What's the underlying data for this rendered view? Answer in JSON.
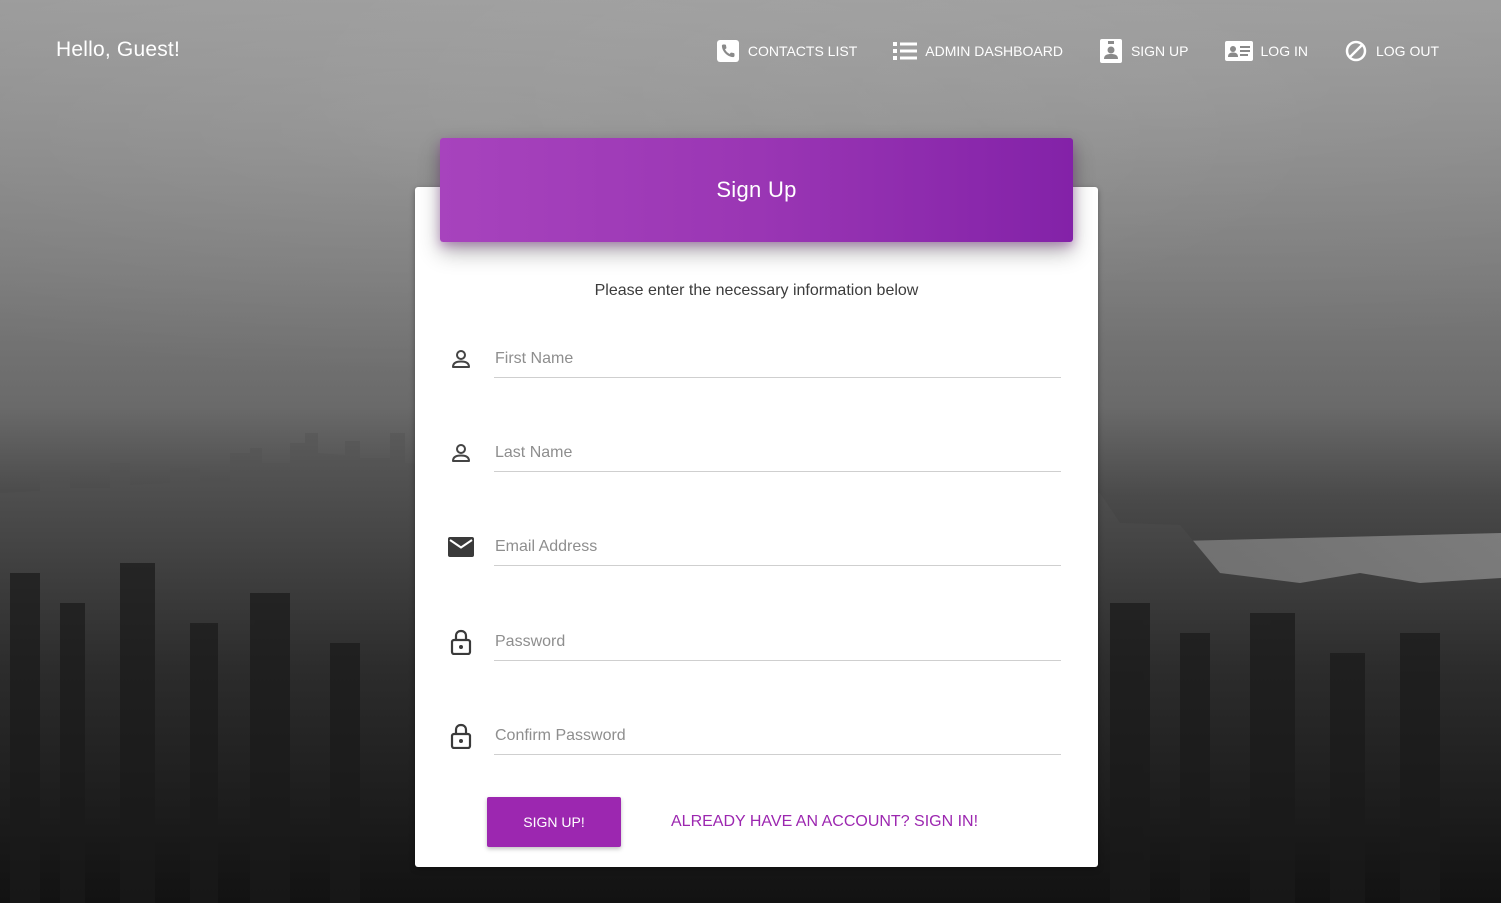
{
  "header": {
    "greeting": "Hello, Guest!",
    "nav": [
      {
        "label": "CONTACTS LIST",
        "icon": "phone-icon"
      },
      {
        "label": "ADMIN DASHBOARD",
        "icon": "list-icon"
      },
      {
        "label": "SIGN UP",
        "icon": "user-badge-icon"
      },
      {
        "label": "LOG IN",
        "icon": "id-card-icon"
      },
      {
        "label": "LOG OUT",
        "icon": "block-icon"
      }
    ]
  },
  "form": {
    "title": "Sign Up",
    "subtitle": "Please enter the necessary information below",
    "fields": [
      {
        "placeholder": "First Name",
        "value": "",
        "icon": "person-icon"
      },
      {
        "placeholder": "Last Name",
        "value": "",
        "icon": "person-icon"
      },
      {
        "placeholder": "Email Address",
        "value": "",
        "icon": "mail-icon"
      },
      {
        "placeholder": "Password",
        "value": "",
        "icon": "lock-icon"
      },
      {
        "placeholder": "Confirm Password",
        "value": "",
        "icon": "lock-icon"
      }
    ],
    "submit_label": "SIGN UP!",
    "signin_link": "ALREADY HAVE AN ACCOUNT? SIGN IN!"
  },
  "colors": {
    "accent": "#9c27b0",
    "header_gradient_start": "#a743bd",
    "header_gradient_end": "#8322a8"
  }
}
